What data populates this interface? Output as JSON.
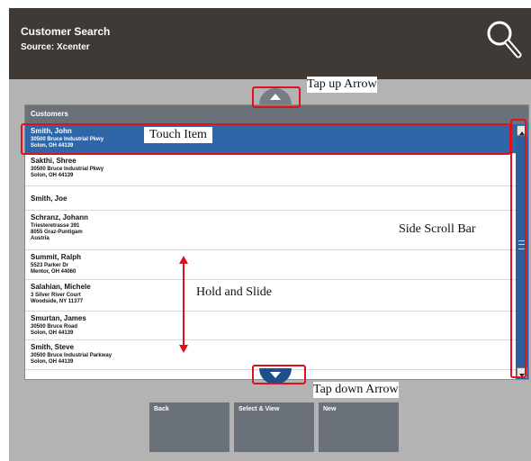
{
  "header": {
    "title": "Customer Search",
    "source": "Source: Xcenter"
  },
  "list": {
    "header_label": "Customers",
    "rows": [
      {
        "name": "Smith, John",
        "address": [
          "30500 Bruce Industrial Pkwy",
          "Solon, OH 44139"
        ],
        "selected": true
      },
      {
        "name": "Sakthi, Shree",
        "address": [
          "30500 Bruce Industrial Pkwy",
          "Solon, OH 44139"
        ],
        "selected": false
      },
      {
        "name": "Smith, Joe",
        "address": [],
        "selected": false
      },
      {
        "name": "Schranz, Johann",
        "address": [
          "Triesteretrasse 391",
          "8055 Graz-Puntigam",
          "Austria"
        ],
        "selected": false
      },
      {
        "name": "Summit, Ralph",
        "address": [
          "5523 Parker Dr",
          "Mentor, OH 44060"
        ],
        "selected": false
      },
      {
        "name": "Salahian, Michele",
        "address": [
          "3 Silver River Court",
          "Woodside, NY 11377"
        ],
        "selected": false
      },
      {
        "name": "Smurtan, James",
        "address": [
          "30500 Bruce Road",
          "Solon, OH 44139"
        ],
        "selected": false
      },
      {
        "name": "Smith, Steve",
        "address": [
          "30500 Bruce Industrial Parkway",
          "Solon, OH 44139"
        ],
        "selected": false
      }
    ]
  },
  "actions": {
    "back": "Back",
    "select_view": "Select & View",
    "new": "New"
  },
  "callouts": {
    "tap_up": "Tap up Arrow",
    "touch_item": "Touch Item",
    "side_scroll": "Side Scroll Bar",
    "hold_slide": "Hold and Slide",
    "tap_down": "Tap down Arrow"
  },
  "colors": {
    "header_bg": "#3f3a36",
    "screen_bg": "#b3b3b3",
    "selected_row": "#2f66a8",
    "button_bg": "#6b7178",
    "callout_red": "#e0101e"
  },
  "icons": {
    "search": "search-icon",
    "up": "chevron-up-icon",
    "down": "chevron-down-icon"
  }
}
